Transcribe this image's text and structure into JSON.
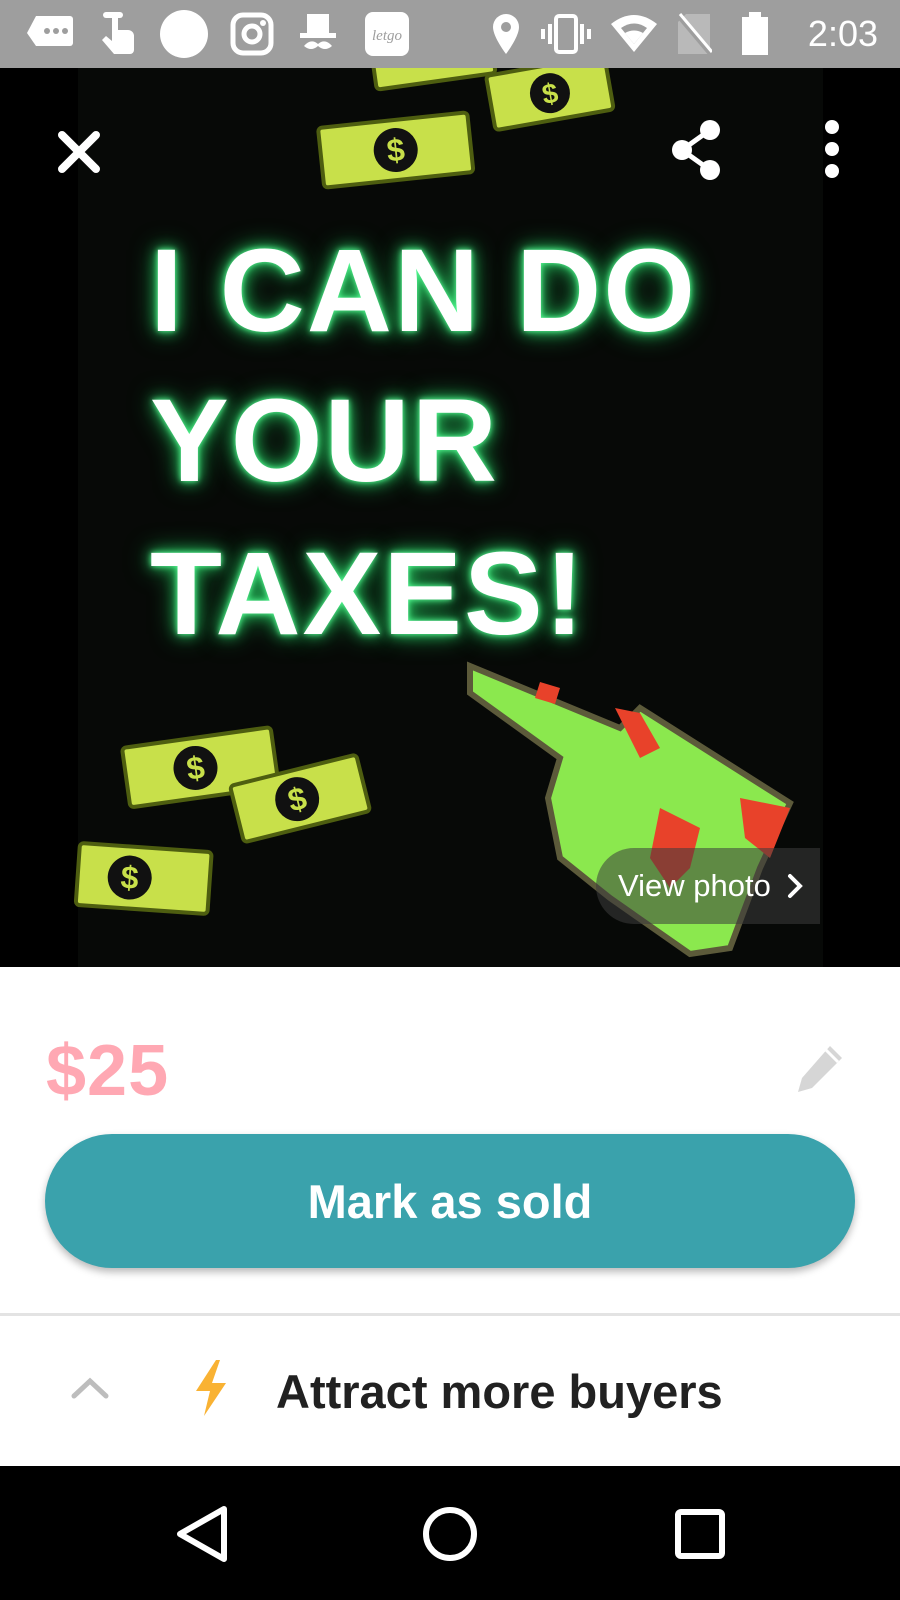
{
  "status_bar": {
    "time": "2:03",
    "icons": [
      "message-icon",
      "hand-icon",
      "circle-icon",
      "instagram-icon",
      "top-hat-icon",
      "letgo-icon",
      "location-icon",
      "vibrate-icon",
      "wifi-icon",
      "no-sim-icon",
      "battery-icon"
    ],
    "letgo_logo_text": "letgo"
  },
  "hero": {
    "poster_text": [
      "I CAN DO",
      "YOUR",
      "TAXES!"
    ],
    "view_photo_label": "View photo"
  },
  "listing": {
    "price": "$25"
  },
  "actions": {
    "mark_sold_label": "Mark as sold",
    "attract_label": "Attract more buyers"
  },
  "colors": {
    "status_bar": "#9e9e9e",
    "price": "#ffa8b3",
    "primary_button": "#3aa2ac",
    "bolt": "#f9b233"
  }
}
